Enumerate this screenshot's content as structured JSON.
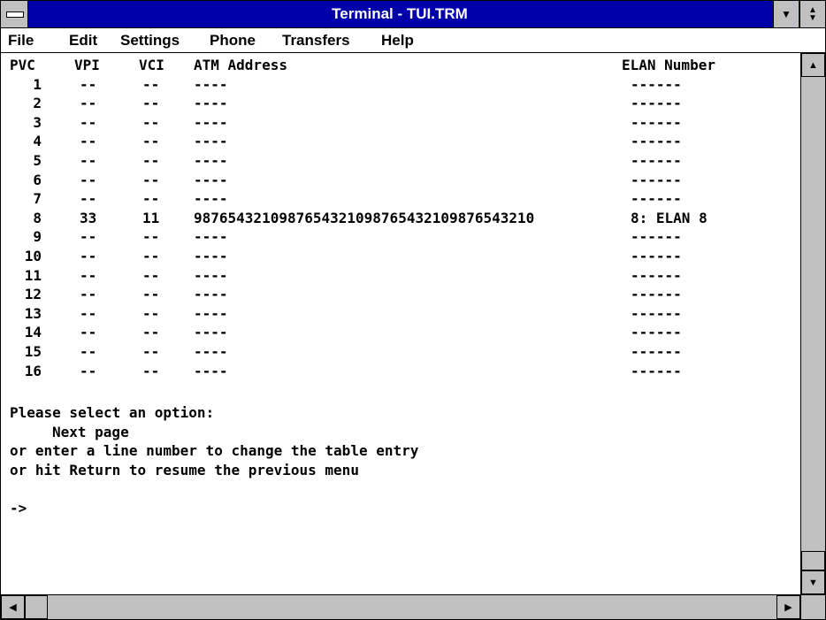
{
  "window": {
    "title": "Terminal - TUI.TRM",
    "controls": {
      "minimize_icon": "triangle-down",
      "maximize_icon": "up-down-arrows"
    }
  },
  "menu": {
    "items": [
      {
        "label": "File"
      },
      {
        "label": "Edit"
      },
      {
        "label": "Settings"
      },
      {
        "label": "Phone"
      },
      {
        "label": "Transfers"
      },
      {
        "label": "Help"
      }
    ]
  },
  "table": {
    "headers": {
      "pvc": "PVC",
      "vpi": "VPI",
      "vci": "VCI",
      "atm": "ATM Address",
      "elan": "ELAN Number"
    },
    "rows": [
      {
        "pvc": "1",
        "vpi": "--",
        "vci": "--",
        "atm": "----",
        "elan": "------"
      },
      {
        "pvc": "2",
        "vpi": "--",
        "vci": "--",
        "atm": "----",
        "elan": "------"
      },
      {
        "pvc": "3",
        "vpi": "--",
        "vci": "--",
        "atm": "----",
        "elan": "------"
      },
      {
        "pvc": "4",
        "vpi": "--",
        "vci": "--",
        "atm": "----",
        "elan": "------"
      },
      {
        "pvc": "5",
        "vpi": "--",
        "vci": "--",
        "atm": "----",
        "elan": "------"
      },
      {
        "pvc": "6",
        "vpi": "--",
        "vci": "--",
        "atm": "----",
        "elan": "------"
      },
      {
        "pvc": "7",
        "vpi": "--",
        "vci": "--",
        "atm": "----",
        "elan": "------"
      },
      {
        "pvc": "8",
        "vpi": "33",
        "vci": "11",
        "atm": "9876543210987654321098765432109876543210",
        "elan": "8: ELAN 8"
      },
      {
        "pvc": "9",
        "vpi": "--",
        "vci": "--",
        "atm": "----",
        "elan": "------"
      },
      {
        "pvc": "10",
        "vpi": "--",
        "vci": "--",
        "atm": "----",
        "elan": "------"
      },
      {
        "pvc": "11",
        "vpi": "--",
        "vci": "--",
        "atm": "----",
        "elan": "------"
      },
      {
        "pvc": "12",
        "vpi": "--",
        "vci": "--",
        "atm": "----",
        "elan": "------"
      },
      {
        "pvc": "13",
        "vpi": "--",
        "vci": "--",
        "atm": "----",
        "elan": "------"
      },
      {
        "pvc": "14",
        "vpi": "--",
        "vci": "--",
        "atm": "----",
        "elan": "------"
      },
      {
        "pvc": "15",
        "vpi": "--",
        "vci": "--",
        "atm": "----",
        "elan": "------"
      },
      {
        "pvc": "16",
        "vpi": "--",
        "vci": "--",
        "atm": "----",
        "elan": "------"
      }
    ]
  },
  "prompt": {
    "line1": "Please select an option:",
    "line2": "Next page",
    "line3": "or enter a line number to change the table entry",
    "line4": "or hit Return to resume the previous menu",
    "cursor": "->"
  }
}
